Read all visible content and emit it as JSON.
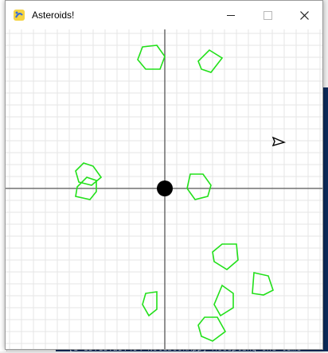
{
  "window": {
    "title": "Asteroids!"
  },
  "background_terminal": {
    "line_text": "[I 13:18:25.494 NotebookApp] Accepting one-time"
  },
  "colors": {
    "asteroid": "#22e01a",
    "grid": "#e6e6e6",
    "axes": "#555555",
    "ship": "#000000",
    "center_body": "#000000"
  },
  "icons": {
    "app": "pygame-snake-icon",
    "minimize": "minimize-icon",
    "maximize": "maximize-icon",
    "close": "close-icon"
  }
}
